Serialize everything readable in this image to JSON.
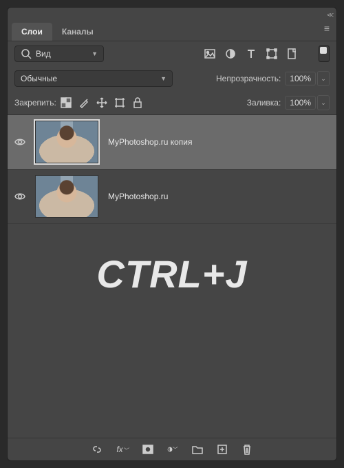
{
  "panel": {
    "collapse_glyph": "<<",
    "menu_glyph": "≡"
  },
  "tabs": {
    "layers": "Слои",
    "channels": "Каналы"
  },
  "filter": {
    "icon": "search-icon",
    "label": "Вид"
  },
  "type_icons": {
    "image": "Изображение",
    "adjust": "Коррекция",
    "text": "Текст",
    "shape": "Фигура",
    "smart": "Смарт"
  },
  "blend": {
    "mode": "Обычные",
    "opacity_label": "Непрозрачность:",
    "opacity_value": "100%"
  },
  "lock": {
    "label": "Закрепить:",
    "fill_label": "Заливка:",
    "fill_value": "100%"
  },
  "layers": [
    {
      "name": "MyPhotoshop.ru копия",
      "selected": true
    },
    {
      "name": "MyPhotoshop.ru",
      "selected": false
    }
  ],
  "overlay_text": "CTRL+J",
  "bottom_icons": {
    "link": "link",
    "fx": "fx",
    "mask": "mask",
    "adj": "adjustment",
    "group": "group",
    "new": "new-layer",
    "trash": "trash"
  }
}
